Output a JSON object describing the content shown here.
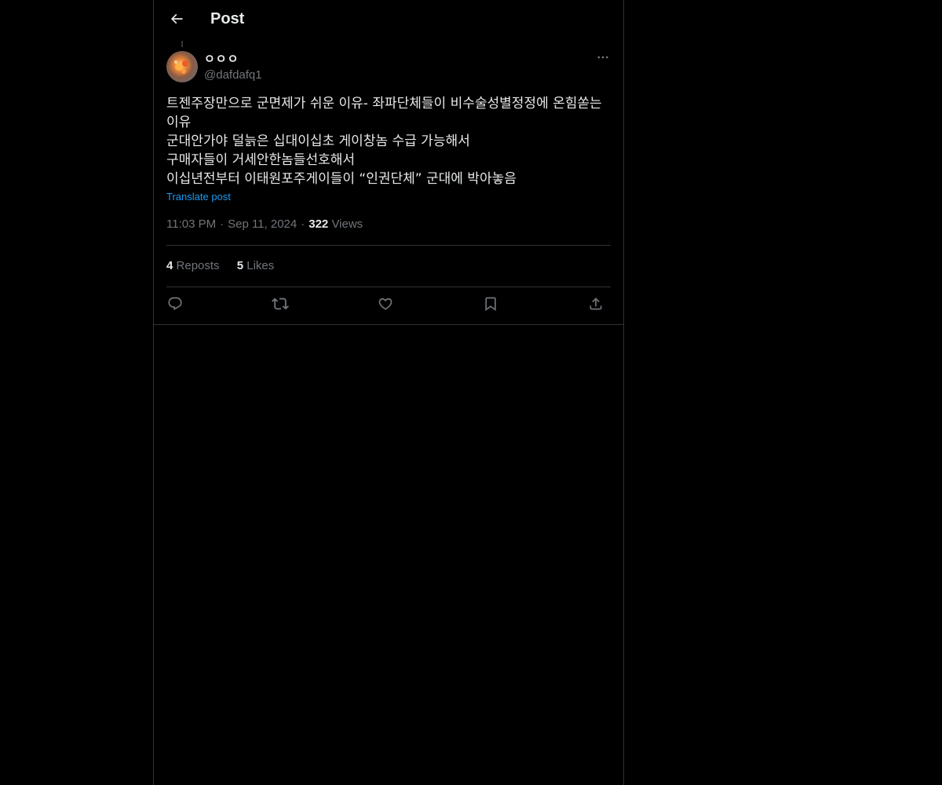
{
  "header": {
    "title": "Post"
  },
  "author": {
    "display_name": "ㅇㅇㅇ",
    "handle": "@dafdafq1"
  },
  "post": {
    "text": "트젠주장만으로 군면제가 쉬운 이유- 좌파단체들이 비수술성별정정에 온힘쏟는 이유\n군대안가야 덜늙은 십대이십초 게이창놈 수급 가능해서\n구매자들이 거세안한놈들선호해서\n이십년전부터 이태원포주게이들이 “인권단체” 군대에 박아놓음",
    "translate_label": "Translate post",
    "time": "11:03 PM",
    "date": "Sep 11, 2024",
    "views_count": "322",
    "views_label": "Views"
  },
  "stats": {
    "reposts_count": "4",
    "reposts_label": "Reposts",
    "likes_count": "5",
    "likes_label": "Likes"
  },
  "icons": {
    "back": "arrow-left-icon",
    "more": "more-horizontal-icon",
    "reply": "reply-icon",
    "repost": "repost-icon",
    "like": "heart-icon",
    "bookmark": "bookmark-icon",
    "share": "share-icon"
  },
  "colors": {
    "background": "#000000",
    "text": "#e7e9ea",
    "secondary_text": "#71767b",
    "link": "#1d9bf0",
    "border": "#2f3336"
  }
}
